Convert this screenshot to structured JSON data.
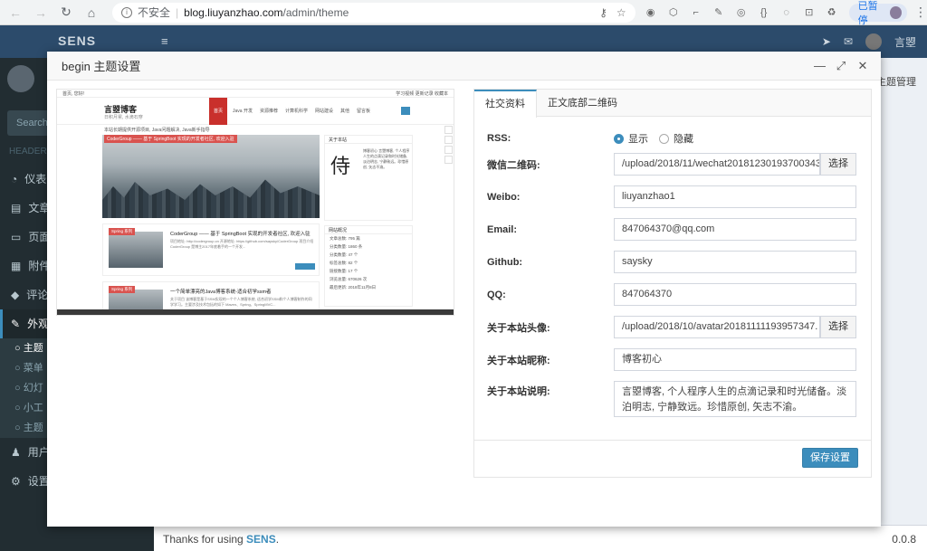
{
  "browser": {
    "insecure_label": "不安全",
    "url_host": "blog.liuyanzhao.com",
    "url_path": "/admin/theme",
    "paused_label": "已暂停"
  },
  "app": {
    "brand": "SENS",
    "user_name": "言曌",
    "sidebar_search": "Search...",
    "sidebar_header": "HEADER",
    "sidebar_items": [
      {
        "label": "仪表"
      },
      {
        "label": "文章"
      },
      {
        "label": "页面"
      },
      {
        "label": "附件"
      },
      {
        "label": "评论"
      },
      {
        "label": "外观"
      }
    ],
    "sidebar_subitems": [
      {
        "label": "主题"
      },
      {
        "label": "菜单"
      },
      {
        "label": "幻灯"
      },
      {
        "label": "小工"
      },
      {
        "label": "主题"
      }
    ],
    "sidebar_bottom": [
      {
        "label": "用户"
      },
      {
        "label": "设置"
      }
    ],
    "breadcrumb": "主题管理",
    "footer_prefix": "Thanks for using ",
    "footer_brand": "SENS",
    "footer_suffix": ".",
    "version": "0.0.8"
  },
  "modal": {
    "title": "begin 主题设置"
  },
  "preview": {
    "top_left": "首页, 您好!",
    "top_right": "学习视频  更新记录  收藏本",
    "logo": "言曌博客",
    "slogan": "日积月累, 水滴石穿",
    "home": "首页",
    "navs": [
      "Java 开发",
      "资源推荐",
      "计算机科学",
      "网站建设",
      "其他",
      "留言板"
    ],
    "notice": "本站长期提供开源项目, Java问题解决, Java新手指导",
    "banner_tag": "CoderGroup —— 基于 SpringBoot 实现的开发者社区, 欢迎入驻",
    "cards": [
      {
        "tag": "Spring 系列",
        "title": "CoderGroup —— 基于 SpringBoot 实现的开发者社区, 欢迎入驻",
        "desc": "项目地址: http://codergroup.cn 开源地址: https://github.com/saysky/CoderGroup 项目介绍 CoderGroup 是博主2017年底着手的一个开发..."
      },
      {
        "tag": "Spring 系列",
        "title": "一个简单漂亮的Java博客系统-适合初学ssm者",
        "desc": "关于项目 该博客是基于SSM实现的一个个人博客系统, 适合初学SSM和个人博客制作的同学学习。主要涉及技术包括的如下 Maven、Spring、SpringMVC..."
      }
    ],
    "widget_about": "关于本站",
    "widget_char": "侍",
    "widget_intro": "博客初心 言曌博客, 个人程序人生的点滴记录和时光储备, 淡泊明志, 宁静致远。珍惜原创, 矢志不渝。",
    "widget_stats_title": "网站概况",
    "stats": [
      "文章总数: 795 篇",
      "分类数量: 1860 条",
      "分类数量: 47 个",
      "标签总数: 82 个",
      "链接数量: 17 个",
      "浏览总量: 670626 次",
      "最后更新: 2018年11月8日"
    ]
  },
  "tabs": [
    {
      "label": "社交资料"
    },
    {
      "label": "正文底部二维码"
    }
  ],
  "form": {
    "rss": {
      "label": "RSS:",
      "opt_show": "显示",
      "opt_hide": "隐藏",
      "selected": "显示"
    },
    "wechat": {
      "label": "微信二维码:",
      "value": "/upload/2018/11/wechat20181230193700343",
      "button": "选择"
    },
    "weibo": {
      "label": "Weibo:",
      "value": "liuyanzhao1"
    },
    "email": {
      "label": "Email:",
      "value": "847064370@qq.com"
    },
    "github": {
      "label": "Github:",
      "value": "saysky"
    },
    "qq": {
      "label": "QQ:",
      "value": "847064370"
    },
    "avatar": {
      "label": "关于本站头像:",
      "value": "/upload/2018/10/avatar20181111193957347.",
      "button": "选择"
    },
    "nickname": {
      "label": "关于本站昵称:",
      "value": "博客初心"
    },
    "desc": {
      "label": "关于本站说明:",
      "value": "言曌博客, 个人程序人生的点滴记录和时光储备。淡泊明志, 宁静致远。珍惜原创, 矢志不渝。"
    },
    "save": "保存设置"
  },
  "colors": {
    "accent": "#3c8dbc",
    "sidebar": "#222d32",
    "header": "#2c4b6b"
  }
}
